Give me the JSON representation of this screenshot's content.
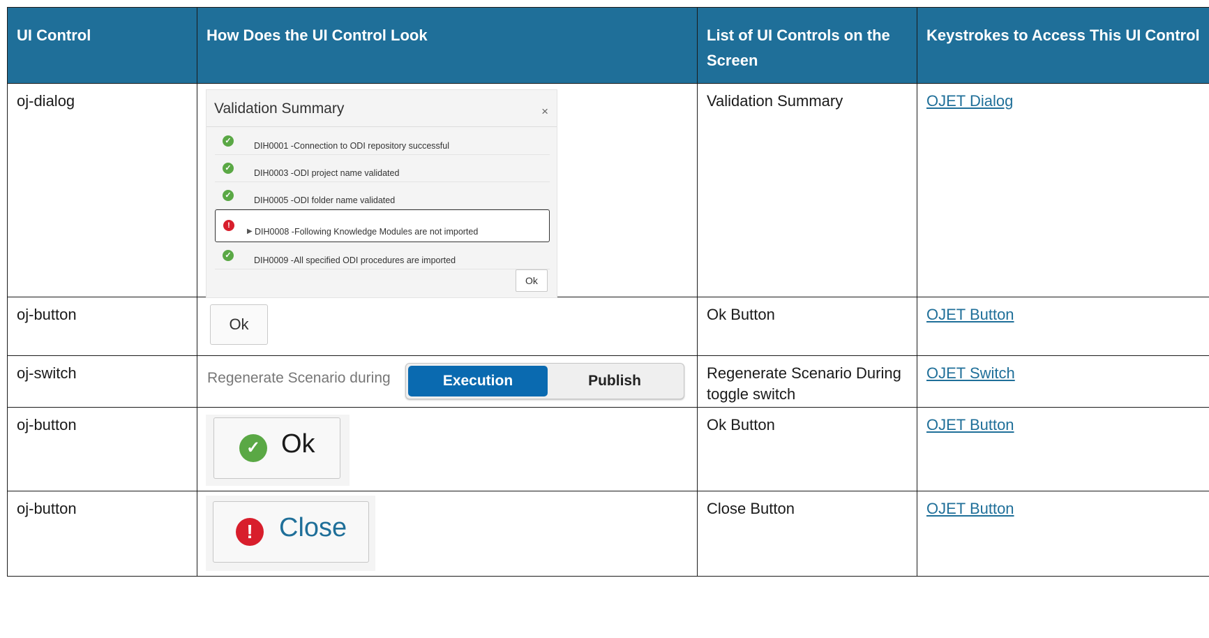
{
  "headers": [
    "UI Control",
    "How Does the UI Control Look",
    "List of UI Controls on the Screen",
    "Keystrokes to Access This UI Control"
  ],
  "rows": [
    {
      "control": "oj-dialog",
      "list": "Validation Summary",
      "link": "OJET Dialog"
    },
    {
      "control": "oj-button",
      "list": "Ok Button",
      "link": "OJET Button"
    },
    {
      "control": "oj-switch",
      "list": "Regenerate Scenario During toggle switch",
      "link": "OJET Switch"
    },
    {
      "control": "oj-button",
      "list": "Ok Button",
      "link": "OJET Button"
    },
    {
      "control": "oj-button",
      "list": "Close Button",
      "link": "OJET Button"
    }
  ],
  "dialog": {
    "title": "Validation Summary",
    "close_glyph": "×",
    "items": [
      {
        "status": "success",
        "text": "DIH0001 -Connection to ODI repository successful"
      },
      {
        "status": "success",
        "text": "DIH0003 -ODI project name validated"
      },
      {
        "status": "success",
        "text": "DIH0005 -ODI folder name validated"
      },
      {
        "status": "error",
        "text": "DIH0008 -Following Knowledge Modules are not imported"
      },
      {
        "status": "success",
        "text": "DIH0009 -All specified ODI procedures are imported"
      }
    ],
    "ok_label": "Ok"
  },
  "ok_button": {
    "label": "Ok"
  },
  "switch": {
    "label": "Regenerate Scenario during",
    "options": [
      "Execution",
      "Publish"
    ],
    "selected": "Execution"
  },
  "ok_icon_button": {
    "label": "Ok",
    "icon": "check-circle-icon"
  },
  "close_button": {
    "label": "Close",
    "icon": "exclamation-circle-icon"
  },
  "colors": {
    "header_bg": "#1f6f99",
    "link": "#1f6f99",
    "switch_active": "#0a6ab0",
    "success": "#5aa845",
    "error": "#d81e2c"
  }
}
